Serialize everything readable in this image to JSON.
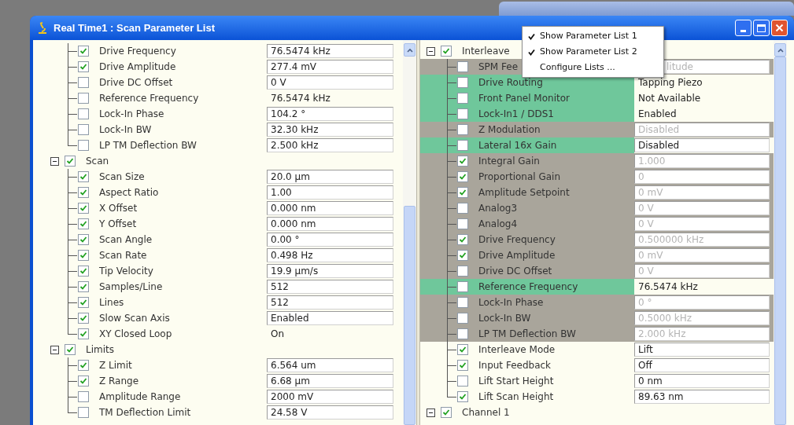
{
  "window": {
    "title": "Real Time1 : Scan Parameter List"
  },
  "left_panel": {
    "items": [
      {
        "kind": "param",
        "label": "Drive Frequency",
        "checked": true,
        "value": "76.5474 kHz",
        "boxed": true
      },
      {
        "kind": "param",
        "label": "Drive Amplitude",
        "checked": true,
        "value": "277.4 mV",
        "boxed": true
      },
      {
        "kind": "param",
        "label": "Drive DC Offset",
        "checked": false,
        "value": "0 V",
        "boxed": true
      },
      {
        "kind": "param",
        "label": "Reference Frequency",
        "checked": false,
        "value": "76.5474 kHz",
        "boxed": false
      },
      {
        "kind": "param",
        "label": "Lock-In Phase",
        "checked": false,
        "value": "104.2 °",
        "boxed": true
      },
      {
        "kind": "param",
        "label": "Lock-In BW",
        "checked": false,
        "value": "32.30 kHz",
        "boxed": true
      },
      {
        "kind": "param",
        "label": "LP TM Deflection BW",
        "checked": false,
        "value": "2.500 kHz",
        "boxed": true
      },
      {
        "kind": "group",
        "label": "Scan",
        "checked": true,
        "expanded": true,
        "children": [
          {
            "kind": "param",
            "label": "Scan Size",
            "checked": true,
            "value": "20.0 µm",
            "boxed": true
          },
          {
            "kind": "param",
            "label": "Aspect Ratio",
            "checked": true,
            "value": "1.00",
            "boxed": true
          },
          {
            "kind": "param",
            "label": "X Offset",
            "checked": true,
            "value": "0.000 nm",
            "boxed": true
          },
          {
            "kind": "param",
            "label": "Y Offset",
            "checked": true,
            "value": "0.000 nm",
            "boxed": true
          },
          {
            "kind": "param",
            "label": "Scan Angle",
            "checked": true,
            "value": "0.00 °",
            "boxed": true
          },
          {
            "kind": "param",
            "label": "Scan Rate",
            "checked": true,
            "value": "0.498 Hz",
            "boxed": true
          },
          {
            "kind": "param",
            "label": "Tip Velocity",
            "checked": true,
            "value": "19.9 µm/s",
            "boxed": true
          },
          {
            "kind": "param",
            "label": "Samples/Line",
            "checked": true,
            "value": "512",
            "boxed": true
          },
          {
            "kind": "param",
            "label": "Lines",
            "checked": true,
            "value": "512",
            "boxed": true
          },
          {
            "kind": "param",
            "label": "Slow Scan Axis",
            "checked": true,
            "value": "Enabled",
            "boxed": true
          },
          {
            "kind": "param",
            "label": "XY Closed Loop",
            "checked": true,
            "value": "On",
            "boxed": false
          }
        ]
      },
      {
        "kind": "group",
        "label": "Limits",
        "checked": true,
        "expanded": true,
        "children": [
          {
            "kind": "param",
            "label": "Z Limit",
            "checked": true,
            "value": "6.564 um",
            "boxed": true
          },
          {
            "kind": "param",
            "label": "Z Range",
            "checked": true,
            "value": "6.68 µm",
            "boxed": true
          },
          {
            "kind": "param",
            "label": "Amplitude Range",
            "checked": false,
            "value": "2000 mV",
            "boxed": true
          },
          {
            "kind": "param",
            "label": "TM Deflection Limit",
            "checked": false,
            "value": "24.58 V",
            "boxed": true
          }
        ]
      }
    ]
  },
  "right_panel": {
    "items": [
      {
        "kind": "group",
        "label": "Interleave",
        "checked": true,
        "expanded": true,
        "children": [
          {
            "kind": "param",
            "label": "SPM Fee",
            "checked": false,
            "value": "litude",
            "boxed": true,
            "disabled": true,
            "under_menu": true,
            "color": "#a9a59b"
          },
          {
            "kind": "param",
            "label": "Drive Routing",
            "checked": false,
            "value": "Tapping Piezo",
            "boxed": false,
            "disabled": false,
            "color": "#6fc79b"
          },
          {
            "kind": "param",
            "label": "Front Panel Monitor",
            "checked": false,
            "value": "Not Available",
            "boxed": false,
            "disabled": false,
            "color": "#6fc79b"
          },
          {
            "kind": "param",
            "label": "Lock-In1 / DDS1",
            "checked": false,
            "value": "Enabled",
            "boxed": false,
            "disabled": false,
            "color": "#6fc79b"
          },
          {
            "kind": "param",
            "label": "Z Modulation",
            "checked": false,
            "value": "Disabled",
            "boxed": true,
            "disabled": true,
            "color": "#a9a59b"
          },
          {
            "kind": "param",
            "label": "Lateral 16x Gain",
            "checked": false,
            "value": "Disabled",
            "boxed": true,
            "disabled": false,
            "color": "#6fc79b"
          },
          {
            "kind": "param",
            "label": "Integral Gain",
            "checked": true,
            "value": "1.000",
            "boxed": true,
            "disabled": true,
            "color": "#a9a59b"
          },
          {
            "kind": "param",
            "label": "Proportional Gain",
            "checked": true,
            "value": "0",
            "boxed": true,
            "disabled": true,
            "color": "#a9a59b"
          },
          {
            "kind": "param",
            "label": "Amplitude Setpoint",
            "checked": true,
            "value": "0 mV",
            "boxed": true,
            "disabled": true,
            "color": "#a9a59b"
          },
          {
            "kind": "param",
            "label": "Analog3",
            "checked": false,
            "value": "0 V",
            "boxed": true,
            "disabled": true,
            "color": "#a9a59b"
          },
          {
            "kind": "param",
            "label": "Analog4",
            "checked": false,
            "value": "0 V",
            "boxed": true,
            "disabled": true,
            "color": "#a9a59b"
          },
          {
            "kind": "param",
            "label": "Drive Frequency",
            "checked": true,
            "value": "0.500000 kHz",
            "boxed": true,
            "disabled": true,
            "color": "#a9a59b"
          },
          {
            "kind": "param",
            "label": "Drive Amplitude",
            "checked": true,
            "value": "0 mV",
            "boxed": true,
            "disabled": true,
            "color": "#a9a59b"
          },
          {
            "kind": "param",
            "label": "Drive DC Offset",
            "checked": false,
            "value": "0 V",
            "boxed": true,
            "disabled": true,
            "color": "#a9a59b"
          },
          {
            "kind": "param",
            "label": "Reference Frequency",
            "checked": false,
            "value": "76.5474 kHz",
            "boxed": false,
            "disabled": false,
            "color": "#6fc79b"
          },
          {
            "kind": "param",
            "label": "Lock-In Phase",
            "checked": false,
            "value": "0 °",
            "boxed": true,
            "disabled": true,
            "color": "#a9a59b"
          },
          {
            "kind": "param",
            "label": "Lock-In BW",
            "checked": false,
            "value": "0.5000 kHz",
            "boxed": true,
            "disabled": true,
            "color": "#a9a59b"
          },
          {
            "kind": "param",
            "label": "LP TM Deflection BW",
            "checked": false,
            "value": "2.000 kHz",
            "boxed": true,
            "disabled": true,
            "color": "#a9a59b"
          },
          {
            "kind": "param",
            "label": "Interleave Mode",
            "checked": true,
            "value": "Lift",
            "boxed": true,
            "disabled": false
          },
          {
            "kind": "param",
            "label": "Input Feedback",
            "checked": true,
            "value": "Off",
            "boxed": true,
            "disabled": false
          },
          {
            "kind": "param",
            "label": "Lift Start Height",
            "checked": false,
            "value": "0 nm",
            "boxed": true,
            "disabled": false
          },
          {
            "kind": "param",
            "label": "Lift Scan Height",
            "checked": true,
            "value": "89.63 nm",
            "boxed": true,
            "disabled": false
          }
        ]
      },
      {
        "kind": "group",
        "label": "Channel 1",
        "checked": true,
        "expanded": true
      }
    ]
  },
  "context_menu": {
    "items": [
      {
        "label": "Show Parameter List 1",
        "checked": true
      },
      {
        "label": "Show Parameter List 2",
        "checked": true
      },
      {
        "label": "Configure Lists ...",
        "checked": false
      }
    ]
  }
}
